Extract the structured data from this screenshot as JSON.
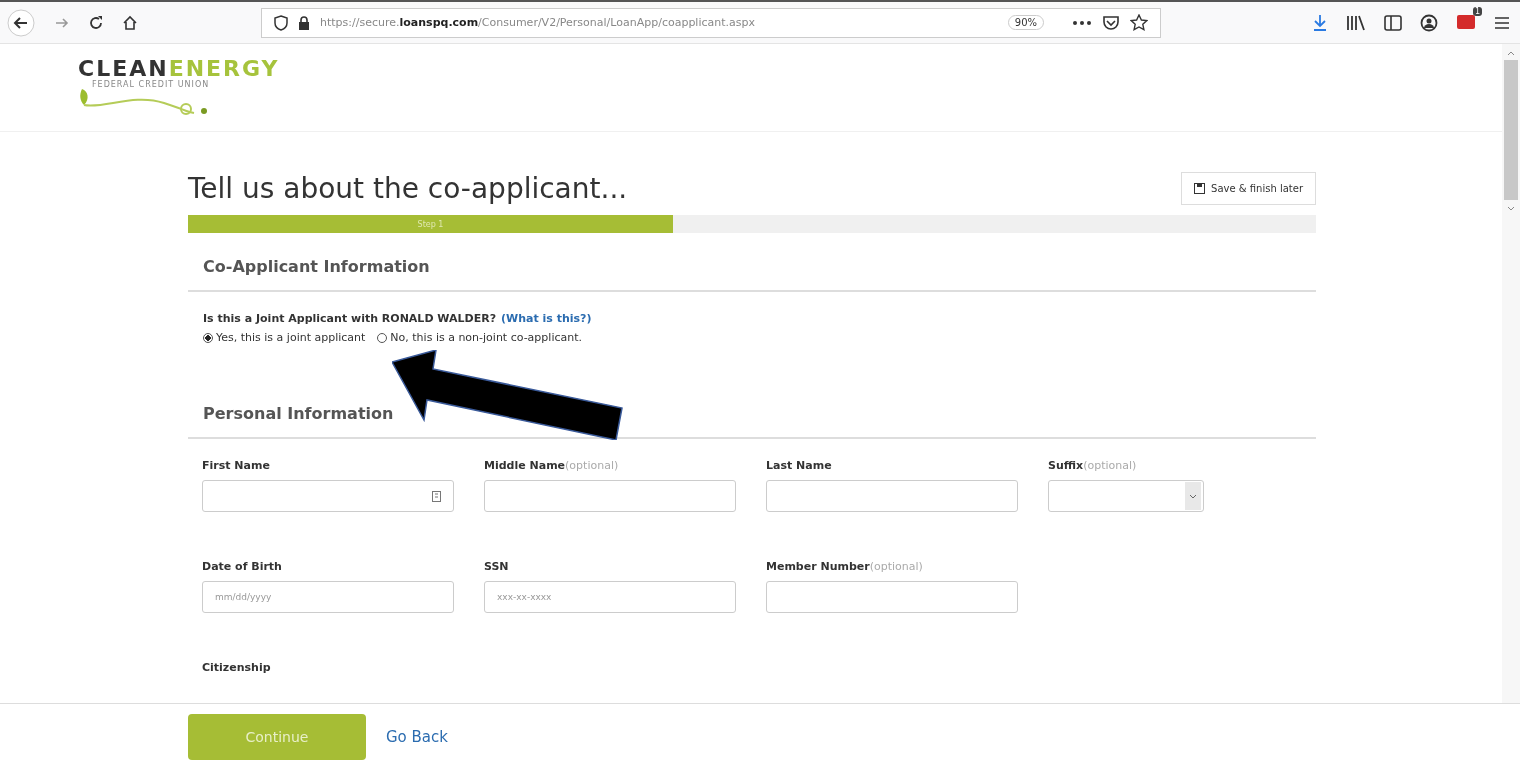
{
  "browser": {
    "url_prefix": "https://secure.",
    "url_domain": "loanspq.com",
    "url_path": "/Consumer/V2/Personal/LoanApp/coapplicant.aspx",
    "zoom": "90%",
    "notification_count": "1"
  },
  "logo": {
    "brand_dark": "CLEAN",
    "brand_light": "ENERGY",
    "tagline": "FEDERAL CREDIT UNION"
  },
  "page": {
    "title": "Tell us about the co-applicant...",
    "save_button": "Save & finish later"
  },
  "progress": {
    "label": "Step 1",
    "level": 0.43
  },
  "coapplicant_section": {
    "heading": "Co-Applicant Information",
    "question": "Is this a Joint Applicant with **RONALD WALDER**?",
    "help_link": "(What is this?)",
    "options": [
      {
        "label": "Yes, this is a joint applicant",
        "selected": true
      },
      {
        "label": "No, this is a non-joint co-applicant.",
        "selected": false
      }
    ]
  },
  "personal_section": {
    "heading": "Personal Information",
    "fields": [
      {
        "label": "First Name",
        "kind": "text",
        "icon": true
      },
      {
        "label": "Middle Name",
        "note": "(optional)",
        "kind": "text"
      },
      {
        "label": "Last Name",
        "kind": "text"
      },
      {
        "label": "Suffix",
        "note": "(optional)",
        "kind": "select"
      },
      {
        "label": "Date of Birth",
        "kind": "text",
        "placeholder": "mm/dd/yyyy"
      },
      {
        "label": "SSN",
        "kind": "text",
        "placeholder": "xxx-xx-xxxx"
      },
      {
        "label": "Member Number",
        "note": "(optional)",
        "kind": "text"
      },
      {
        "label": "Citizenship",
        "kind": "label"
      }
    ]
  },
  "footer": {
    "continue_button": "Continue",
    "back_link": "Go Back"
  }
}
